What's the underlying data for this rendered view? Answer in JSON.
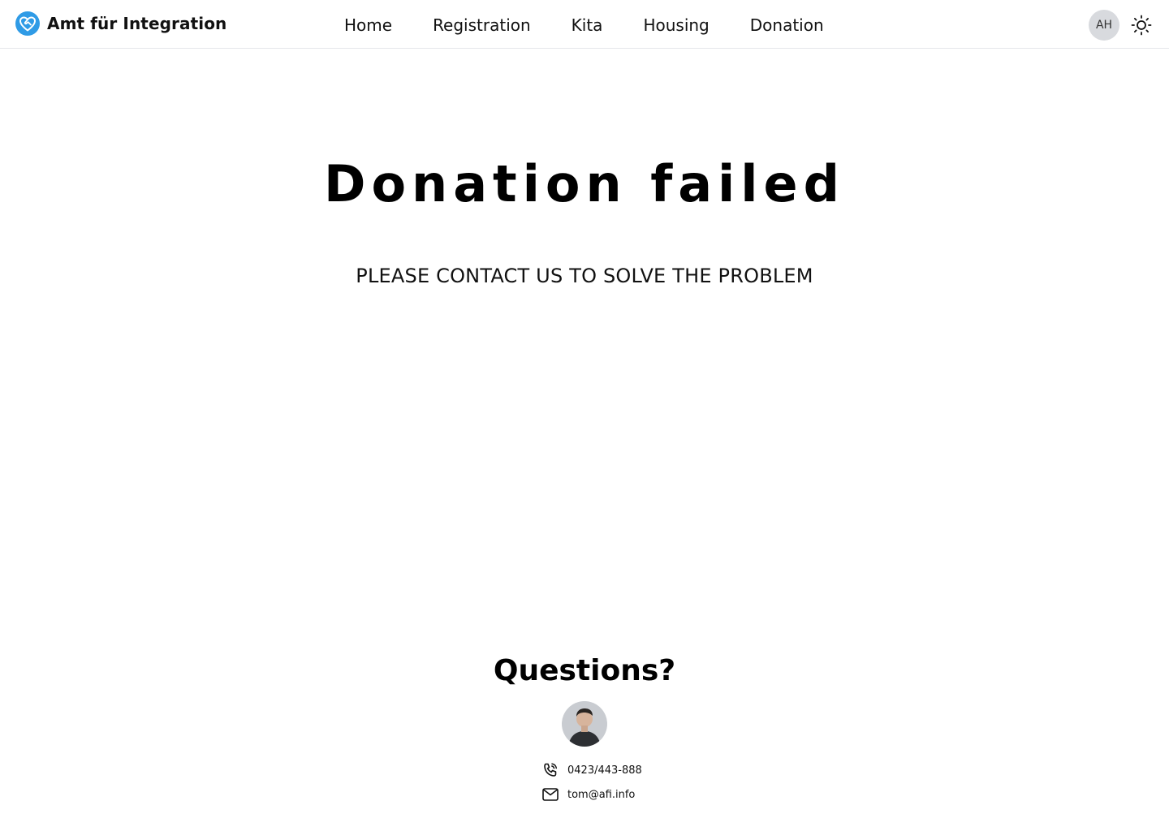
{
  "header": {
    "brand_name": "Amt für Integration",
    "logo_icon": "heart-handshake-logo",
    "nav": [
      {
        "label": "Home"
      },
      {
        "label": "Registration"
      },
      {
        "label": "Kita"
      },
      {
        "label": "Housing"
      },
      {
        "label": "Donation"
      }
    ],
    "user_initials": "AH",
    "theme_icon": "sun-icon"
  },
  "main": {
    "title": "Donation failed",
    "subtitle": "PLEASE CONTACT US TO SOLVE THE PROBLEM"
  },
  "contact": {
    "heading": "Questions?",
    "phone": "0423/443-888",
    "email": "tom@afi.info",
    "phone_icon": "phone-call-icon",
    "email_icon": "mail-icon"
  },
  "colors": {
    "brand_blue": "#2f9be6",
    "avatar_bg": "#d8dade",
    "divider": "#e5e7eb"
  }
}
